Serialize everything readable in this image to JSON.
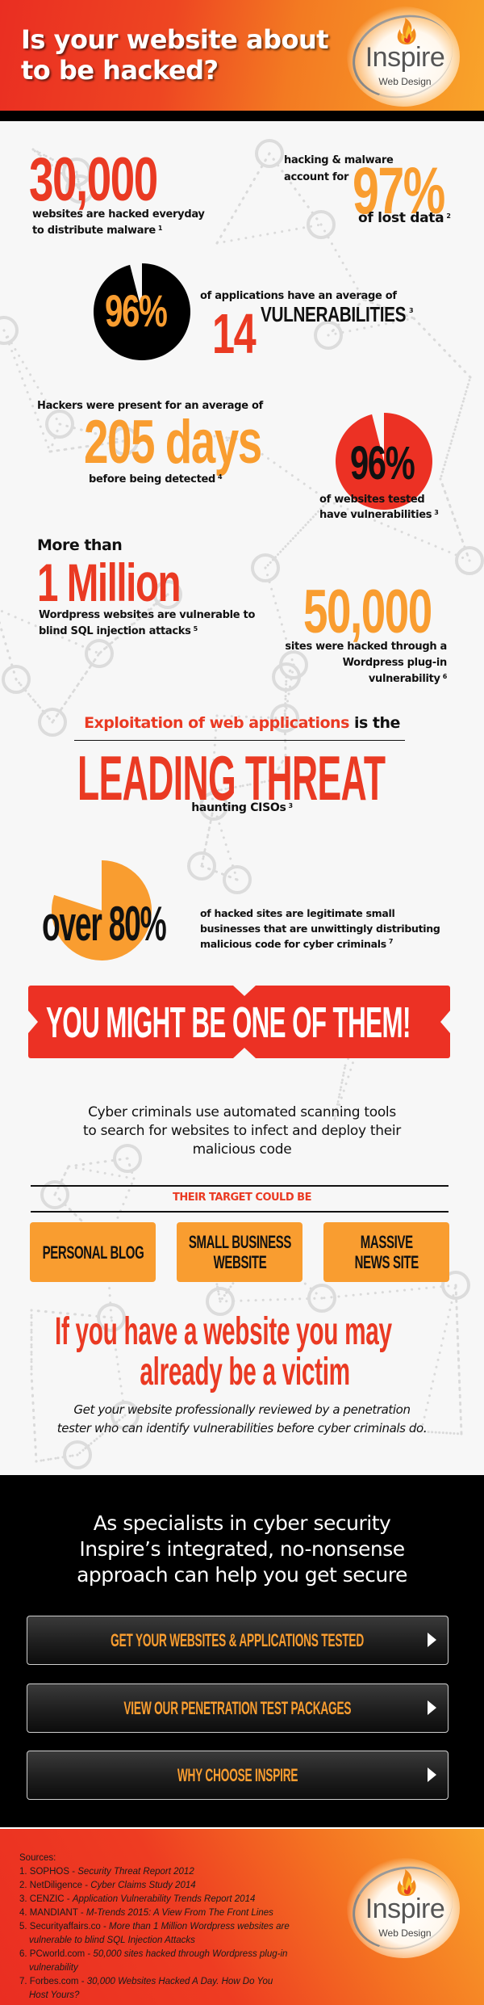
{
  "header": {
    "title_line1": "Is your website about",
    "title_line2": "to be hacked?",
    "logo": {
      "name": "Inspire",
      "tagline": "Web Design",
      "icon": "flame-icon"
    }
  },
  "stats": {
    "s1": {
      "value": "30,000",
      "caption_line1": "websites are hacked everyday",
      "caption_line2": "to distribute malware",
      "ref": "1"
    },
    "s2": {
      "caption_line1": "hacking & malware",
      "caption_line2": "account for",
      "value": "97%",
      "caption_line3": "of lost data",
      "ref": "2"
    },
    "s3": {
      "value": "96%",
      "percent": 96,
      "caption": "of applications have an average of",
      "count": "14",
      "count_label": "VULNERABILITIES",
      "ref": "3"
    },
    "s4": {
      "caption_top": "Hackers were present for an average of",
      "value": "205 days",
      "caption_bottom": "before being detected",
      "ref": "4"
    },
    "s5": {
      "value": "96%",
      "percent": 96,
      "caption_line1": "of websites tested",
      "caption_line2": "have vulnerabilities",
      "ref": "3"
    },
    "s6": {
      "lead": "More than",
      "value": "1 Million",
      "caption_line1": "Wordpress websites are vulnerable to",
      "caption_line2": "blind SQL injection attacks",
      "ref": "5"
    },
    "s7": {
      "value": "50,000",
      "caption_line1": "sites were hacked through a",
      "caption_line2": "Wordpress plug-in vulnerability",
      "ref": "6"
    },
    "leading": {
      "highlight": "Exploitation of web applications",
      "rest": " is the",
      "headline": "LEADING THREAT",
      "sub": "haunting CISOs",
      "ref": "3"
    },
    "s8": {
      "value": "over 80%",
      "percent": 80,
      "caption_line1": "of hacked sites are legitimate small",
      "caption_line2": "businesses that are unwittingly distributing",
      "caption_line3": "malicious code for cyber criminals",
      "ref": "7"
    }
  },
  "banner": {
    "text": "YOU MIGHT BE ONE OF THEM!"
  },
  "scan_text": {
    "line1": "Cyber criminals use automated scanning tools",
    "line2": "to search for websites to infect and deploy their",
    "line3": "malicious code"
  },
  "targets": {
    "heading": "THEIR TARGET COULD BE",
    "items": [
      {
        "line1": "PERSONAL BLOG",
        "line2": ""
      },
      {
        "line1": "SMALL BUSINESS",
        "line2": "WEBSITE"
      },
      {
        "line1": "MASSIVE",
        "line2": "NEWS SITE"
      }
    ]
  },
  "victim": {
    "headline_line1": "If you have a website you may",
    "headline_line2": "already be a victim",
    "body_line1": "Get your website professionally reviewed by a penetration",
    "body_line2": "tester who can identify vulnerabilities before cyber criminals do."
  },
  "cta_section": {
    "title_line1": "As specialists in cyber security",
    "title_line2": "Inspire’s integrated, no-nonsense",
    "title_line3": "approach can help you get secure",
    "buttons": [
      {
        "label": "GET YOUR WEBSITES & APPLICATIONS TESTED",
        "icon": "arrow-right-icon"
      },
      {
        "label": "VIEW OUR PENETRATION TEST PACKAGES",
        "icon": "arrow-right-icon"
      },
      {
        "label": "WHY CHOOSE INSPIRE",
        "icon": "arrow-right-icon"
      }
    ]
  },
  "footer": {
    "sources_label": "Sources:",
    "sources": [
      {
        "num": "1.",
        "org": "SOPHOS",
        "title": "Security Threat Report 2012"
      },
      {
        "num": "2.",
        "org": "NetDiligence",
        "title": "Cyber Claims Study 2014"
      },
      {
        "num": "3.",
        "org": "CENZIC",
        "title": "Application Vulnerability Trends Report 2014"
      },
      {
        "num": "4.",
        "org": "MANDIANT",
        "title": "M-Trends 2015: A View From The Front Lines"
      },
      {
        "num": "5.",
        "org": "Securityaffairs.co",
        "title": "More than 1 Million Wordpress websites are vulnerable to blind SQL Injection Attacks"
      },
      {
        "num": "6.",
        "org": "PCworld.com",
        "title": "50,000 sites hacked through Wordpress plug-in vulnerability"
      },
      {
        "num": "7.",
        "org": "Forbes.com",
        "title": "30,000 Websites Hacked A Day. How Do You Host Yours?"
      }
    ],
    "logo": {
      "name": "Inspire",
      "tagline": "Web Design"
    }
  },
  "colors": {
    "red": "#ea3a23",
    "orange": "#f99d30",
    "black": "#111111",
    "background": "#f7f7f7"
  }
}
